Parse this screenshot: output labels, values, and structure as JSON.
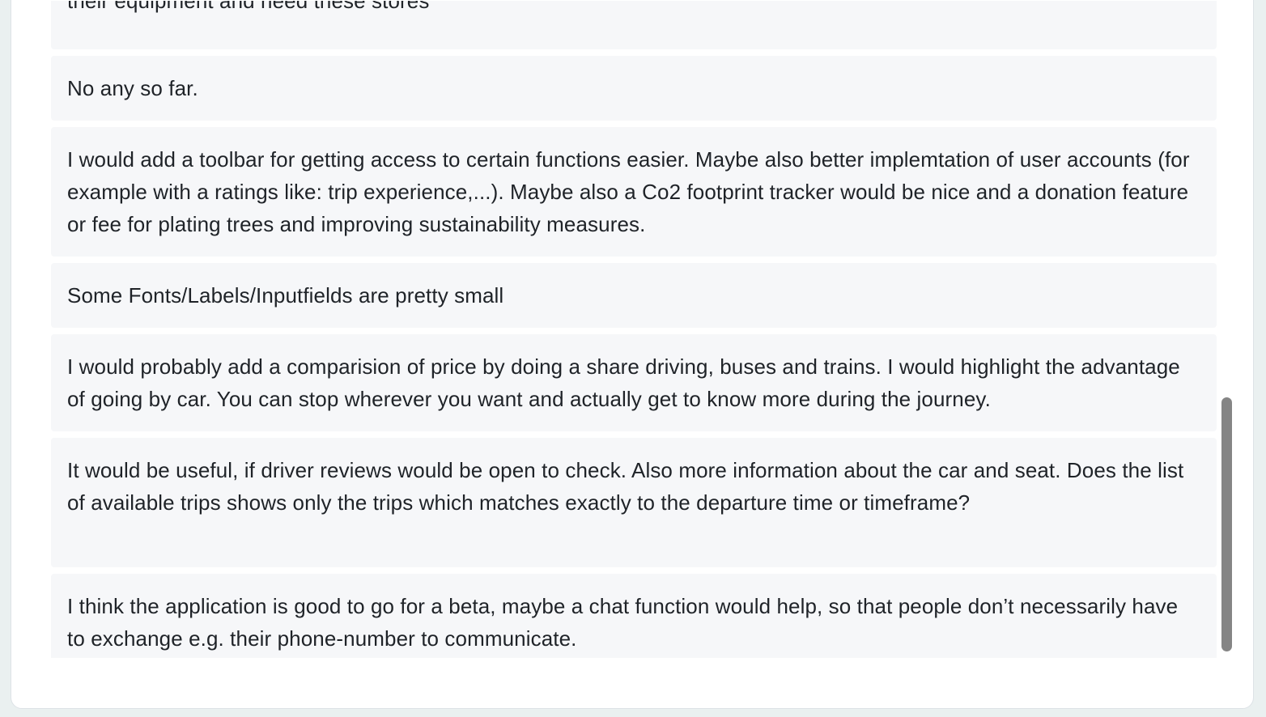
{
  "responses": [
    {
      "text": "their equipment and need these stores"
    },
    {
      "text": "No any so far."
    },
    {
      "text": "I would add a toolbar for getting access to certain functions easier. Maybe also better implemtation of user accounts (for example with a ratings like: trip experience,...). Maybe also a Co2 footprint tracker would be nice and a donation feature or fee for plating trees and improving sustainability measures."
    },
    {
      "text": "Some Fonts/Labels/Inputfields are pretty small"
    },
    {
      "text": "I would probably add a comparision of price by doing a share driving, buses and trains. I would highlight the advantage of going by car. You can stop wherever you want and actually get to know more during the journey."
    },
    {
      "text": "It would be useful, if driver reviews would be open to check. Also more information about the car and seat. Does the list of available trips shows only the trips which matches exactly to the departure time or timeframe?"
    },
    {
      "text": "I think the application is good to go for a beta, maybe a chat function would help, so that people don’t necessarily have to exchange e.g. their phone-number to communicate."
    }
  ],
  "colors": {
    "page_background": "#eaf0f0",
    "panel_background": "#ffffff",
    "response_background": "#f6f7f9",
    "text": "#1f2328",
    "scrollbar_thumb": "#858585"
  }
}
